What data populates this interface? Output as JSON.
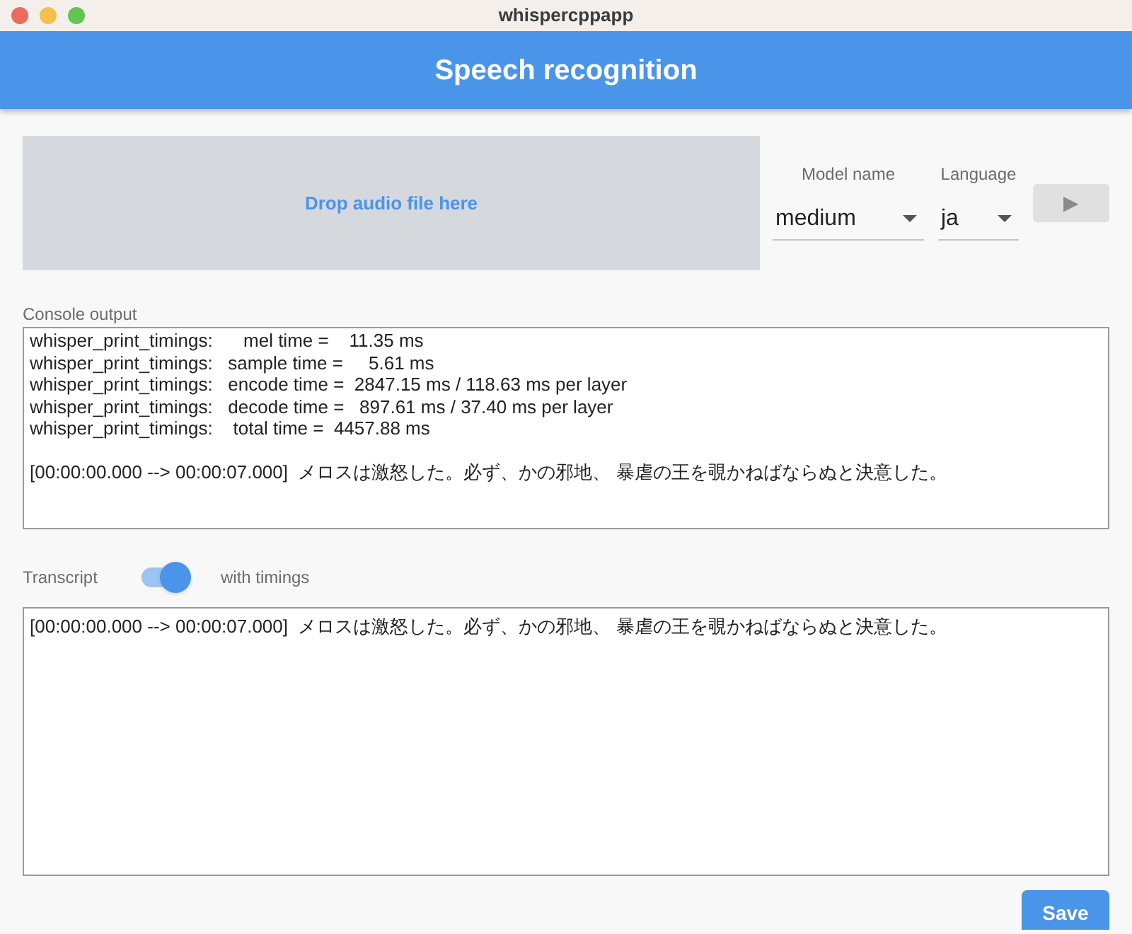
{
  "window": {
    "title": "whispercppapp"
  },
  "header": {
    "title": "Speech recognition"
  },
  "drop_zone": {
    "label": "Drop audio file here"
  },
  "model": {
    "label": "Model name",
    "value": "medium"
  },
  "language": {
    "label": "Language",
    "value": "ja"
  },
  "run_button": {
    "icon": "▶",
    "disabled": true
  },
  "console": {
    "label": "Console output",
    "lines": [
      "whisper_print_timings:      mel time =    11.35 ms",
      "whisper_print_timings:   sample time =     5.61 ms",
      "whisper_print_timings:   encode time =  2847.15 ms / 118.63 ms per layer",
      "whisper_print_timings:   decode time =   897.61 ms / 37.40 ms per layer",
      "whisper_print_timings:    total time =  4457.88 ms"
    ],
    "result": "[00:00:00.000 --> 00:00:07.000]  メロスは激怒した。必ず、かの邪地、 暴虐の王を覗かねばならぬと決意した。"
  },
  "transcript": {
    "label": "Transcript",
    "toggle_label": "with timings",
    "timings_on": true,
    "text": "[00:00:00.000 --> 00:00:07.000]  メロスは激怒した。必ず、かの邪地、 暴虐の王を覗かねばならぬと決意した。"
  },
  "save_button": {
    "label": "Save"
  }
}
